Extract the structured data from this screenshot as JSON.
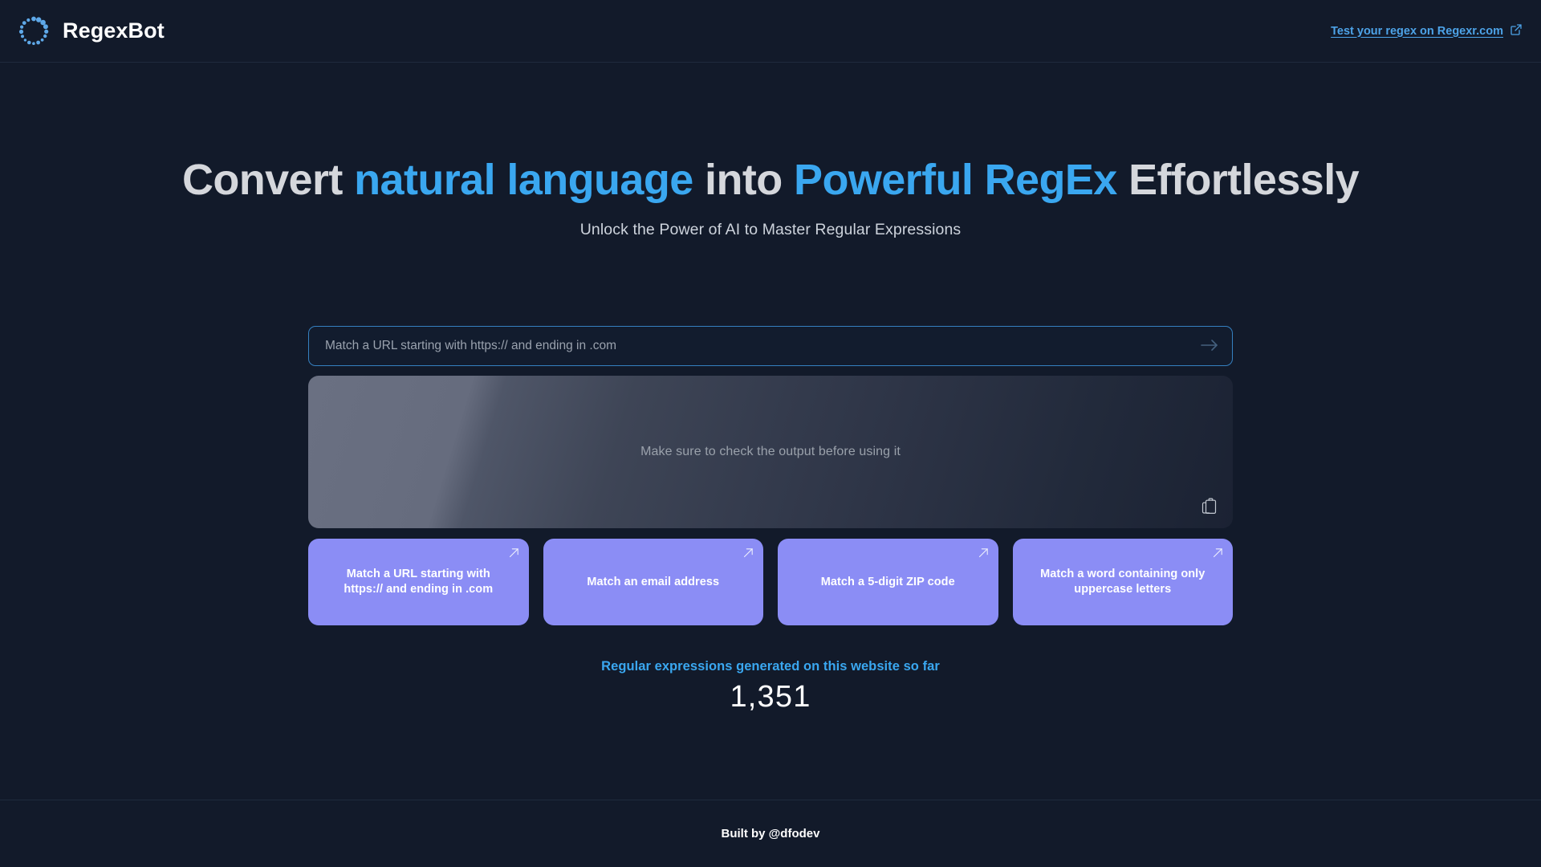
{
  "header": {
    "logo_icon": "dotted-ring-logo-icon",
    "brand_name": "RegexBot",
    "link_text": "Test your regex on Regexr.com",
    "link_icon": "external-link-icon"
  },
  "hero": {
    "title_part1": "Convert ",
    "title_highlight1": "natural language",
    "title_part2": " into ",
    "title_highlight2": "Powerful RegEx",
    "title_part3": " Effortlessly",
    "subtitle": "Unlock the Power of AI to Master Regular Expressions"
  },
  "search": {
    "value": "",
    "placeholder": "Match a URL starting with https:// and ending in .com",
    "submit_icon": "arrow-right-icon"
  },
  "output": {
    "placeholder": "Make sure to check the output before using it",
    "copy_icon": "copy-icon",
    "value": ""
  },
  "suggestions": [
    {
      "label": "Match a URL starting with https:// and ending in .com",
      "icon": "arrow-up-right-icon"
    },
    {
      "label": "Match an email address",
      "icon": "arrow-up-right-icon"
    },
    {
      "label": "Match a 5-digit ZIP code",
      "icon": "arrow-up-right-icon"
    },
    {
      "label": "Match a word containing only uppercase letters",
      "icon": "arrow-up-right-icon"
    }
  ],
  "counter": {
    "label": "Regular expressions generated on this website so far",
    "value": "1,351"
  },
  "footer": {
    "text": "Built by @dfodev"
  },
  "colors": {
    "page_background": "#121a2a",
    "accent_blue": "#3aa7f0",
    "link_blue": "#4da3e8",
    "card_purple": "#8b8df5",
    "heading_gray": "#d5d7dc",
    "border": "#1f2a3d"
  }
}
